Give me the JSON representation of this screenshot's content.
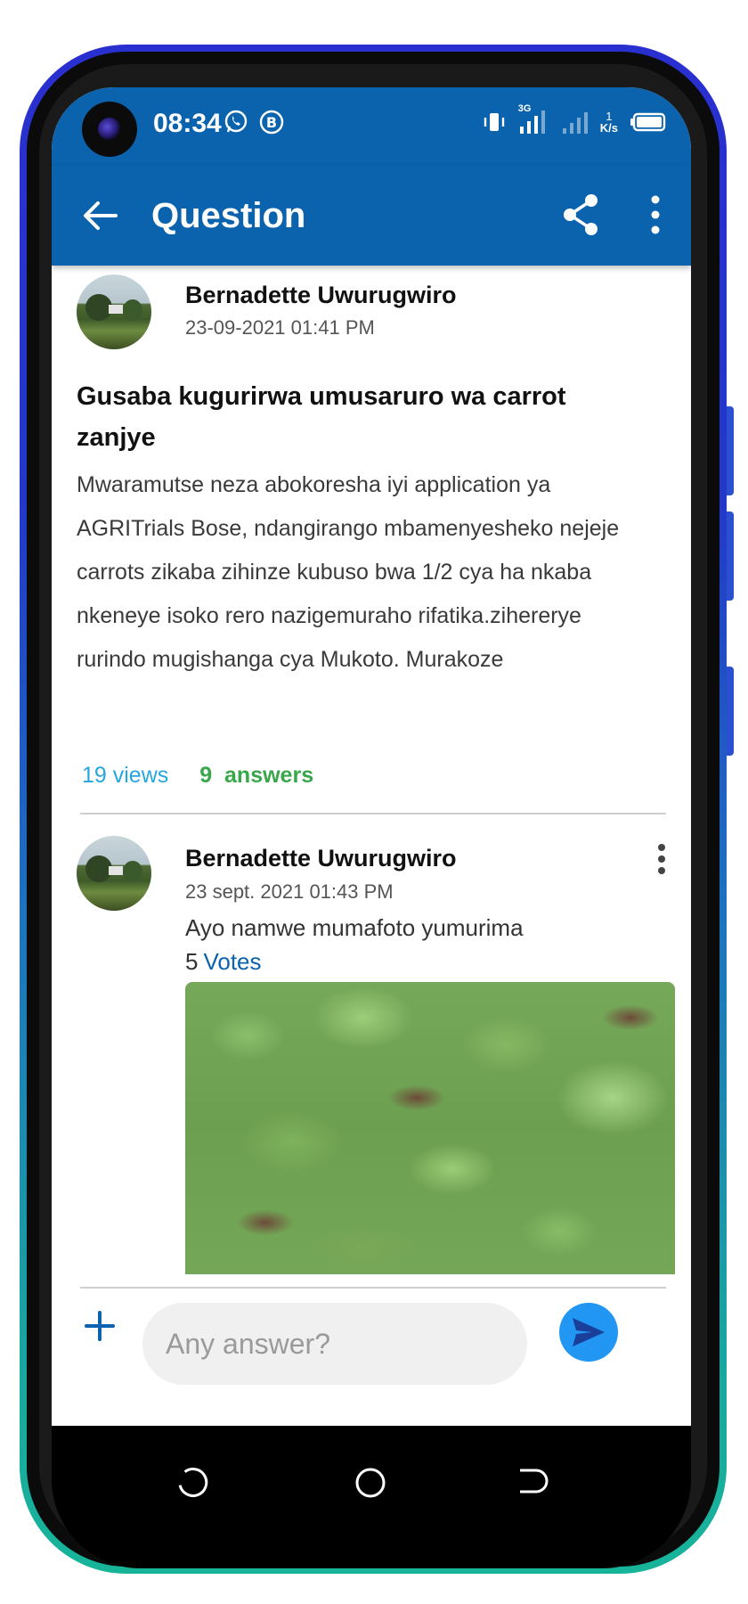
{
  "status_bar": {
    "time": "08:34",
    "network_label": "3G",
    "speed_value": "1",
    "speed_unit": "K/s"
  },
  "app_bar": {
    "title": "Question"
  },
  "question": {
    "author": "Bernadette Uwurugwiro",
    "date": "23-09-2021 01:41 PM",
    "title": "Gusaba kugurirwa umusaruro wa carrot zanjye",
    "body": "Mwaramutse neza abokoresha iyi application ya AGRITrials Bose, ndangirango mbamenyesheko nejeje carrots zikaba zihinze kubuso bwa 1/2 cya ha nkaba nkeneye isoko rero nazigemuraho rifatika.zihererye rurindo mugishanga cya Mukoto. Murakoze",
    "views": "19 views",
    "answers_count": "9",
    "answers_label": "answers"
  },
  "answer": {
    "author": "Bernadette Uwurugwiro",
    "date": "23 sept. 2021 01:43 PM",
    "text": "Ayo namwe mumafoto yumurima",
    "votes_count": "5",
    "votes_label": "Votes"
  },
  "composer": {
    "placeholder": "Any answer?"
  },
  "colors": {
    "primary": "#0b62ad",
    "views": "#26a6e0",
    "answers": "#3aa64a",
    "send": "#2196f3"
  }
}
